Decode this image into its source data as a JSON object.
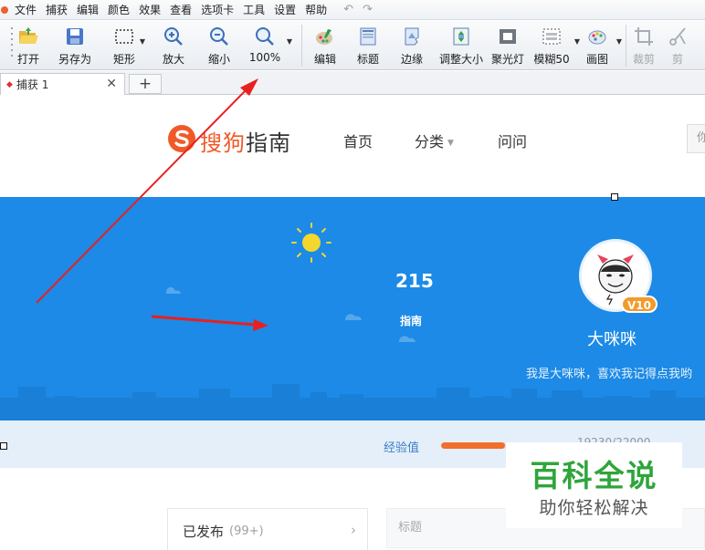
{
  "menu": [
    "文件",
    "捕获",
    "编辑",
    "颜色",
    "效果",
    "查看",
    "选项卡",
    "工具",
    "设置",
    "帮助"
  ],
  "toolbar": {
    "open": "打开",
    "save_as": "另存为",
    "rectangle": "矩形",
    "zoom_in": "放大",
    "zoom_out": "缩小",
    "zoom_level": "100%",
    "edit": "编辑",
    "caption": "标题",
    "edge": "边缘",
    "resize": "调整大小",
    "spotlight": "聚光灯",
    "blur": "模糊50",
    "draw": "画图",
    "crop": "裁剪",
    "cut": "剪"
  },
  "tabs": [
    {
      "label": "捕获 1"
    }
  ],
  "site": {
    "logo_prefix": "搜狗",
    "logo_suffix": "指南",
    "nav": [
      {
        "label": "首页"
      },
      {
        "label": "分类"
      },
      {
        "label": "问问"
      }
    ],
    "search_placeholder": "你"
  },
  "profile": {
    "guides_count": "215",
    "guides_label": "指南",
    "level": "V10",
    "name": "大咪咪",
    "bio": "我是大咪咪，喜欢我记得点我哟",
    "exp_label": "经验值",
    "exp_progress": 0.39,
    "exp_count": "19230/22000"
  },
  "content": {
    "published_label": "已发布",
    "published_count": "(99+)",
    "title_placeholder": "标题"
  },
  "watermark": {
    "title": "百科全说",
    "subtitle": "助你轻松解决"
  },
  "colors": {
    "banner": "#1c8ae6",
    "accent_orange": "#f26e2c",
    "arrow_red": "#e8201f",
    "watermark_green": "#2fa53b"
  }
}
